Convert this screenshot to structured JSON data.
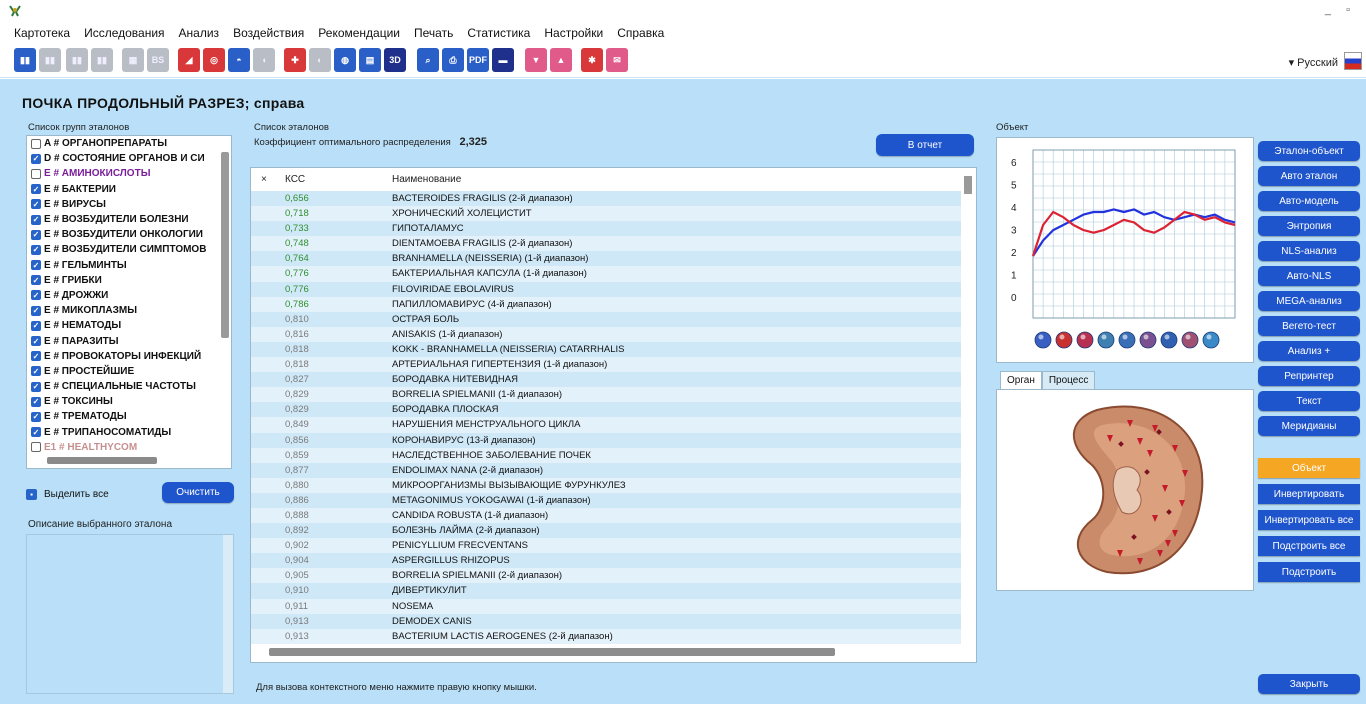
{
  "window": {
    "controls": "_  ▫"
  },
  "menu": [
    "Картотека",
    "Исследования",
    "Анализ",
    "Воздействия",
    "Рекомендации",
    "Печать",
    "Статистика",
    "Настройки",
    "Справка"
  ],
  "toolbar": {
    "language": "▾ Русский",
    "buttons": [
      {
        "icon": "bars-chart-icon",
        "style": "blue",
        "glyph": "▮▮"
      },
      {
        "icon": "bars-gray-icon",
        "style": "gray",
        "glyph": "▮▮"
      },
      {
        "icon": "bars-gray-icon-2",
        "style": "gray",
        "glyph": "▮▮"
      },
      {
        "icon": "bars-gray-icon-3",
        "style": "gray",
        "glyph": "▮▮"
      },
      {
        "icon": "grid-gray-icon",
        "style": "gray",
        "glyph": "▦"
      },
      {
        "icon": "bs-gray-icon",
        "style": "gray",
        "glyph": "BS"
      },
      {
        "icon": "graph-icon",
        "style": "red",
        "glyph": "◢"
      },
      {
        "icon": "target-icon",
        "style": "red",
        "glyph": "◎"
      },
      {
        "icon": "organ-icon",
        "style": "blue",
        "glyph": "◓"
      },
      {
        "icon": "drop-gray-icon",
        "style": "gray",
        "glyph": "◖"
      },
      {
        "icon": "cross-icon",
        "style": "red",
        "glyph": "✚"
      },
      {
        "icon": "capsule-gray-icon",
        "style": "gray",
        "glyph": "◐"
      },
      {
        "icon": "pill-icon",
        "style": "blue",
        "glyph": "◍"
      },
      {
        "icon": "book-icon",
        "style": "blue",
        "glyph": "▤"
      },
      {
        "icon": "3d-icon",
        "style": "navy",
        "glyph": "3D"
      },
      {
        "icon": "search-icon",
        "style": "blue",
        "glyph": "⌕"
      },
      {
        "icon": "printer-icon",
        "style": "blue",
        "glyph": "⎙"
      },
      {
        "icon": "pdf-icon",
        "style": "blue",
        "glyph": "PDF"
      },
      {
        "icon": "notebook-icon",
        "style": "navy",
        "glyph": "▬"
      },
      {
        "icon": "export-icon",
        "style": "pink",
        "glyph": "▼"
      },
      {
        "icon": "import-icon",
        "style": "pink",
        "glyph": "▲"
      },
      {
        "icon": "puzzle-icon",
        "style": "red",
        "glyph": "✱"
      },
      {
        "icon": "mail-icon",
        "style": "pink",
        "glyph": "✉"
      }
    ]
  },
  "title": "ПОЧКА ПРОДОЛЬНЫЙ РАЗРЕЗ; справа",
  "groups": {
    "label": "Список групп эталонов",
    "items": [
      {
        "text": "A # ОРГАНОПРЕПАРАТЫ",
        "checked": false,
        "color": "#111111"
      },
      {
        "text": "D # СОСТОЯНИЕ ОРГАНОВ И СИ",
        "checked": true,
        "color": "#111111"
      },
      {
        "text": "E # АМИНОКИСЛОТЫ",
        "checked": false,
        "color": "#7a1f9a"
      },
      {
        "text": "E # БАКТЕРИИ",
        "checked": true,
        "color": "#111111"
      },
      {
        "text": "E # ВИРУСЫ",
        "checked": true,
        "color": "#111111"
      },
      {
        "text": "E # ВОЗБУДИТЕЛИ БОЛЕЗНИ",
        "checked": true,
        "color": "#111111"
      },
      {
        "text": "E # ВОЗБУДИТЕЛИ ОНКОЛОГИИ",
        "checked": true,
        "color": "#111111"
      },
      {
        "text": "E # ВОЗБУДИТЕЛИ СИМПТОМОВ",
        "checked": true,
        "color": "#111111"
      },
      {
        "text": "E # ГЕЛЬМИНТЫ",
        "checked": true,
        "color": "#111111"
      },
      {
        "text": "E # ГРИБКИ",
        "checked": true,
        "color": "#111111"
      },
      {
        "text": "E # ДРОЖЖИ",
        "checked": true,
        "color": "#111111"
      },
      {
        "text": "E # МИКОПЛАЗМЫ",
        "checked": true,
        "color": "#111111"
      },
      {
        "text": "E # НЕМАТОДЫ",
        "checked": true,
        "color": "#111111"
      },
      {
        "text": "E # ПАРАЗИТЫ",
        "checked": true,
        "color": "#111111"
      },
      {
        "text": "E # ПРОВОКАТОРЫ ИНФЕКЦИЙ",
        "checked": true,
        "color": "#111111"
      },
      {
        "text": "E # ПРОСТЕЙШИЕ",
        "checked": true,
        "color": "#111111"
      },
      {
        "text": "E # СПЕЦИАЛЬНЫЕ ЧАСТОТЫ",
        "checked": true,
        "color": "#111111"
      },
      {
        "text": "E # ТОКСИНЫ",
        "checked": true,
        "color": "#111111"
      },
      {
        "text": "E # ТРЕМАТОДЫ",
        "checked": true,
        "color": "#111111"
      },
      {
        "text": "E # ТРИПАНОСОМАТИДЫ",
        "checked": true,
        "color": "#111111"
      },
      {
        "text": "E1 # HEALTHYCOM",
        "checked": false,
        "color": "#c79090"
      }
    ]
  },
  "select_all_label": "Выделить все",
  "clear_button": "Очистить",
  "description_label": "Описание выбранного эталона",
  "etalons": {
    "label": "Список эталонов",
    "coef_label": "Коэффициент оптимального распределения",
    "coef_value": "2,325",
    "report_button": "В отчет",
    "columns": [
      "×",
      "КСС",
      "Наименование"
    ],
    "rows": [
      {
        "kcc": "0,656",
        "name": "BACTEROIDES FRAGILIS (2-й диапазон)",
        "green": true
      },
      {
        "kcc": "0,718",
        "name": "ХРОНИЧЕСКИЙ ХОЛЕЦИСТИТ",
        "green": true
      },
      {
        "kcc": "0,733",
        "name": "ГИПОТАЛАМУС",
        "green": true
      },
      {
        "kcc": "0,748",
        "name": "DIENTAMOEBA FRAGILIS (2-й диапазон)",
        "green": true
      },
      {
        "kcc": "0,764",
        "name": "BRANHAMELLA (NEISSERIA) (1-й диапазон)",
        "green": true
      },
      {
        "kcc": "0,776",
        "name": "БАКТЕРИАЛЬНАЯ КАПСУЛА (1-й диапазон)",
        "green": true
      },
      {
        "kcc": "0,776",
        "name": "FILOVIRIDAE EBOLAVIRUS",
        "green": true
      },
      {
        "kcc": "0,786",
        "name": "ПАПИЛЛОМАВИРУС (4-й диапазон)",
        "green": true
      },
      {
        "kcc": "0,810",
        "name": "ОСТРАЯ БОЛЬ",
        "green": false
      },
      {
        "kcc": "0,816",
        "name": "ANISAKIS (1-й диапазон)",
        "green": false
      },
      {
        "kcc": "0,818",
        "name": "KOKK - BRANHAMELLA (NEISSERIA) CATARRHALIS",
        "green": false
      },
      {
        "kcc": "0,818",
        "name": "АРТЕРИАЛЬНАЯ ГИПЕРТЕНЗИЯ (1-й диапазон)",
        "green": false
      },
      {
        "kcc": "0,827",
        "name": "БОРОДАВКА НИТЕВИДНАЯ",
        "green": false
      },
      {
        "kcc": "0,829",
        "name": "BORRELIA SPIELMANII (1-й диапазон)",
        "green": false
      },
      {
        "kcc": "0,829",
        "name": "БОРОДАВКА ПЛОСКАЯ",
        "green": false
      },
      {
        "kcc": "0,849",
        "name": "НАРУШЕНИЯ МЕНСТРУАЛЬНОГО ЦИКЛА",
        "green": false
      },
      {
        "kcc": "0,856",
        "name": "КОРОНАВИРУС (13-й диапазон)",
        "green": false
      },
      {
        "kcc": "0,859",
        "name": "НАСЛЕДСТВЕННОЕ ЗАБОЛЕВАНИЕ ПОЧЕК",
        "green": false
      },
      {
        "kcc": "0,877",
        "name": "ENDOLIMAX NANA (2-й диапазон)",
        "green": false
      },
      {
        "kcc": "0,880",
        "name": "МИКРООРГАНИЗМЫ ВЫЗЫВАЮЩИЕ ФУРУНКУЛЕЗ",
        "green": false
      },
      {
        "kcc": "0,886",
        "name": "METAGONIMUS YOKOGAWAI (1-й диапазон)",
        "green": false
      },
      {
        "kcc": "0,888",
        "name": "CANDIDA ROBUSTA (1-й диапазон)",
        "green": false
      },
      {
        "kcc": "0,892",
        "name": "БОЛЕЗНЬ ЛАЙМА (2-й диапазон)",
        "green": false
      },
      {
        "kcc": "0,902",
        "name": "PENICYLLIUM FRECVENTANS",
        "green": false
      },
      {
        "kcc": "0,904",
        "name": "ASPERGILLUS RHIZOPUS",
        "green": false
      },
      {
        "kcc": "0,905",
        "name": "BORRELIA SPIELMANII (2-й диапазон)",
        "green": false
      },
      {
        "kcc": "0,910",
        "name": "ДИВЕРТИКУЛИТ",
        "green": false
      },
      {
        "kcc": "0,911",
        "name": "NOSEMA",
        "green": false
      },
      {
        "kcc": "0,913",
        "name": "DEMODEX CANIS",
        "green": false
      },
      {
        "kcc": "0,913",
        "name": "BACTERIUM LACTIS AEROGENES (2-й диапазон)",
        "green": false
      }
    ]
  },
  "footer_hint": "Для вызова контекстного меню нажмите правую кнопку мышки.",
  "object": {
    "label": "Объект",
    "y_ticks": [
      "6",
      "5",
      "4",
      "3",
      "2",
      "1",
      "0"
    ],
    "chart_icons": [
      "body-icon",
      "liver-icon",
      "heart-icon",
      "lungs-icon",
      "spine-icon",
      "brain-icon",
      "eye-icon",
      "kidney-icon",
      "globe-icon"
    ]
  },
  "chart_data": {
    "type": "line",
    "ylim": [
      0,
      6.5
    ],
    "x": [
      0,
      1,
      2,
      3,
      4,
      5,
      6,
      7,
      8,
      9,
      10,
      11,
      12,
      13,
      14,
      15,
      16,
      17,
      18,
      19,
      20
    ],
    "series": [
      {
        "color": "#2233dd",
        "values": [
          2.4,
          3.0,
          3.4,
          3.6,
          3.8,
          4.0,
          4.1,
          4.1,
          4.2,
          4.1,
          4.2,
          4.0,
          4.1,
          3.9,
          3.8,
          3.9,
          4.0,
          3.9,
          4.0,
          3.8,
          3.7
        ]
      },
      {
        "color": "#dd2233",
        "values": [
          2.4,
          3.6,
          4.1,
          3.9,
          3.6,
          3.4,
          3.3,
          3.4,
          3.6,
          3.8,
          3.7,
          3.4,
          3.3,
          3.5,
          3.8,
          4.1,
          4.0,
          3.8,
          3.9,
          3.7,
          3.6
        ]
      }
    ]
  },
  "organ_tabs": [
    "Орган",
    "Процесс"
  ],
  "right_buttons": [
    "Эталон-объект",
    "Авто эталон",
    "Авто-модель",
    "Энтропия",
    "NLS-анализ",
    "Авто-NLS",
    "MEGA-анализ",
    "Вегето-тест",
    "Анализ +",
    "Репринтер",
    "Текст",
    "Меридианы"
  ],
  "action_buttons": [
    "Объект",
    "Инвертировать",
    "Инвертировать все",
    "Подстроить все",
    "Подстроить"
  ],
  "close_button": "Закрыть",
  "colors": {
    "accent": "#1f55cc",
    "background": "#b9e0f8",
    "active_action": "#f5a623"
  }
}
